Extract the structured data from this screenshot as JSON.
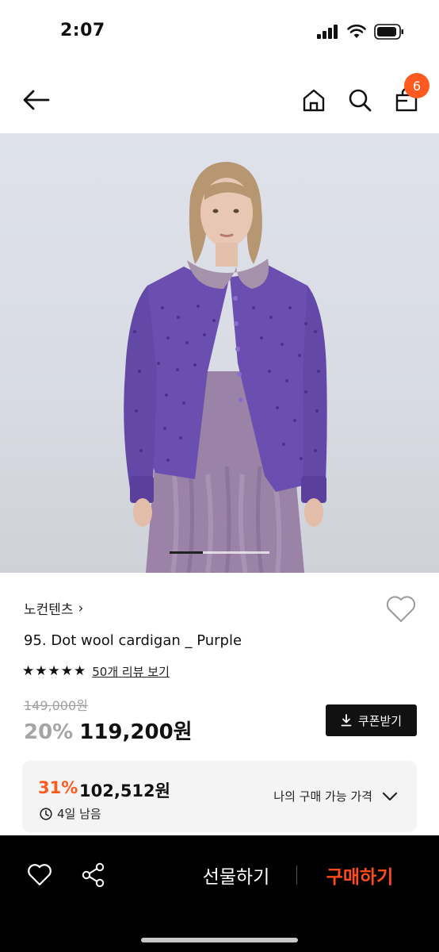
{
  "status": {
    "time": "2:07"
  },
  "header": {
    "cart_count": "6"
  },
  "carousel": {
    "progress": 0.33
  },
  "product": {
    "brand": "노컨텐츠",
    "brand_chevron": "›",
    "name": "95. Dot wool cardigan _ Purple",
    "rating": 5,
    "review_link": "50개 리뷰 보기",
    "original_price": "149,000원",
    "discount_rate": "20%",
    "sale_price": "119,200원",
    "coupon_button": "쿠폰받기"
  },
  "my_price": {
    "rate": "31%",
    "price": "102,512원",
    "remaining": "4일 남음",
    "label": "나의 구매 가능 가격"
  },
  "bottom_bar": {
    "gift_button": "선물하기",
    "buy_button": "구매하기"
  },
  "colors": {
    "accent": "#ff5a1f",
    "buy": "#ff4b17",
    "cardigan": "#6b4fb0",
    "dress": "#9a83a6"
  },
  "icons": [
    "back-arrow-icon",
    "home-icon",
    "search-icon",
    "shopping-bag-icon",
    "heart-icon",
    "share-icon",
    "download-icon",
    "clock-icon",
    "chevron-down-icon",
    "star-icon"
  ]
}
